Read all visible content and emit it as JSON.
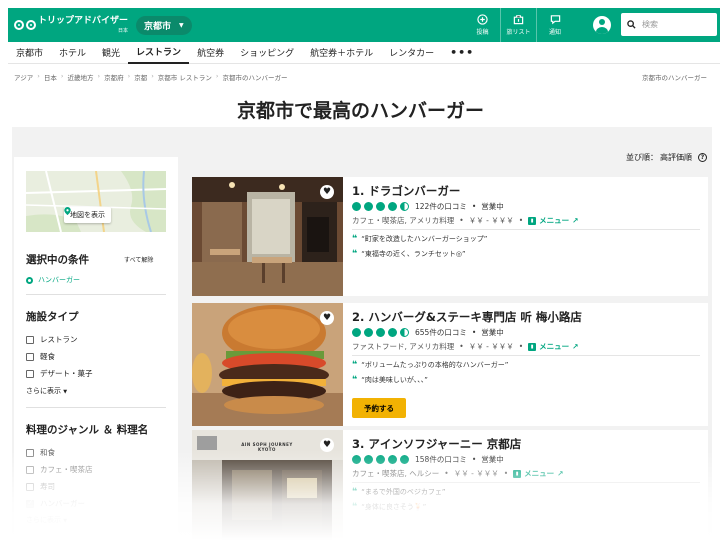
{
  "header": {
    "logo_text": "トリップアドバイザー",
    "logo_sub": "日本",
    "city": "京都市",
    "icons": [
      {
        "name": "post-icon",
        "label": "投稿"
      },
      {
        "name": "trip-list-icon",
        "label": "旅リスト"
      },
      {
        "name": "notification-icon",
        "label": "通知"
      }
    ],
    "search_placeholder": "検索",
    "brand_color": "#00a680"
  },
  "nav": {
    "items": [
      "京都市",
      "ホテル",
      "観光",
      "レストラン",
      "航空券",
      "ショッピング",
      "航空券＋ホテル",
      "レンタカー"
    ],
    "active": "レストラン",
    "more": "•••"
  },
  "breadcrumbs": [
    "アジア",
    "日本",
    "近畿地方",
    "京都府",
    "京都",
    "京都市 レストラン",
    "京都市のハンバーガー"
  ],
  "breadcrumb_right": "京都市のハンバーガー",
  "page_title": "京都市で最高のハンバーガー",
  "sort": {
    "label": "並び順：",
    "value": "高評価順",
    "help": "?"
  },
  "sidebar": {
    "map_button": "地図を表示",
    "selected_heading": "選択中の条件",
    "clear_all": "すべて解除",
    "selected_filter": "ハンバーガー",
    "facility_heading": "施設タイプ",
    "facility_types": [
      "レストラン",
      "軽食",
      "デザート・菓子"
    ],
    "show_more": "さらに表示",
    "cuisine_heading": "料理のジャンル ＆ 料理名",
    "cuisines": [
      {
        "label": "和食",
        "checked": false
      },
      {
        "label": "カフェ・喫茶店",
        "checked": false
      },
      {
        "label": "寿司",
        "checked": false
      },
      {
        "label": "ハンバーガー",
        "checked": true
      }
    ],
    "show_more_2": "さらに表示"
  },
  "restaurants": [
    {
      "title": "1. ドラゴンバーガー",
      "rating": 4.5,
      "reviews": "122件の口コミ",
      "status": "営業中",
      "categories": "カフェ・喫茶店, アメリカ料理",
      "price": "￥￥ - ￥￥￥",
      "menu": "メニュー",
      "quotes": [
        "“町家を改造したハンバーガーショップ”",
        "“東福寺の近く、ランチセット◎”"
      ]
    },
    {
      "title": "2. ハンバーグ&ステーキ専門店 听 梅小路店",
      "rating": 4.5,
      "reviews": "655件の口コミ",
      "status": "営業中",
      "categories": "ファストフード, アメリカ料理",
      "price": "￥￥ - ￥￥￥",
      "menu": "メニュー",
      "quotes": [
        "“ボリュームたっぷりの本格的なハンバーガー”",
        "“肉は美味しいが、、、”"
      ],
      "reserve": "予約する"
    },
    {
      "title": "3. アインソフジャーニー 京都店",
      "rating": 5,
      "reviews": "158件の口コミ",
      "status": "営業中",
      "categories": "カフェ・喫茶店, ヘルシー",
      "price": "￥￥ - ￥￥￥",
      "menu": "メニュー",
      "quotes": [
        "“まるで外国のベジカフェ”",
        "“身体に良さそう🍹”"
      ],
      "sign": "AIN SOPH JOURNEY KYOTO"
    }
  ]
}
